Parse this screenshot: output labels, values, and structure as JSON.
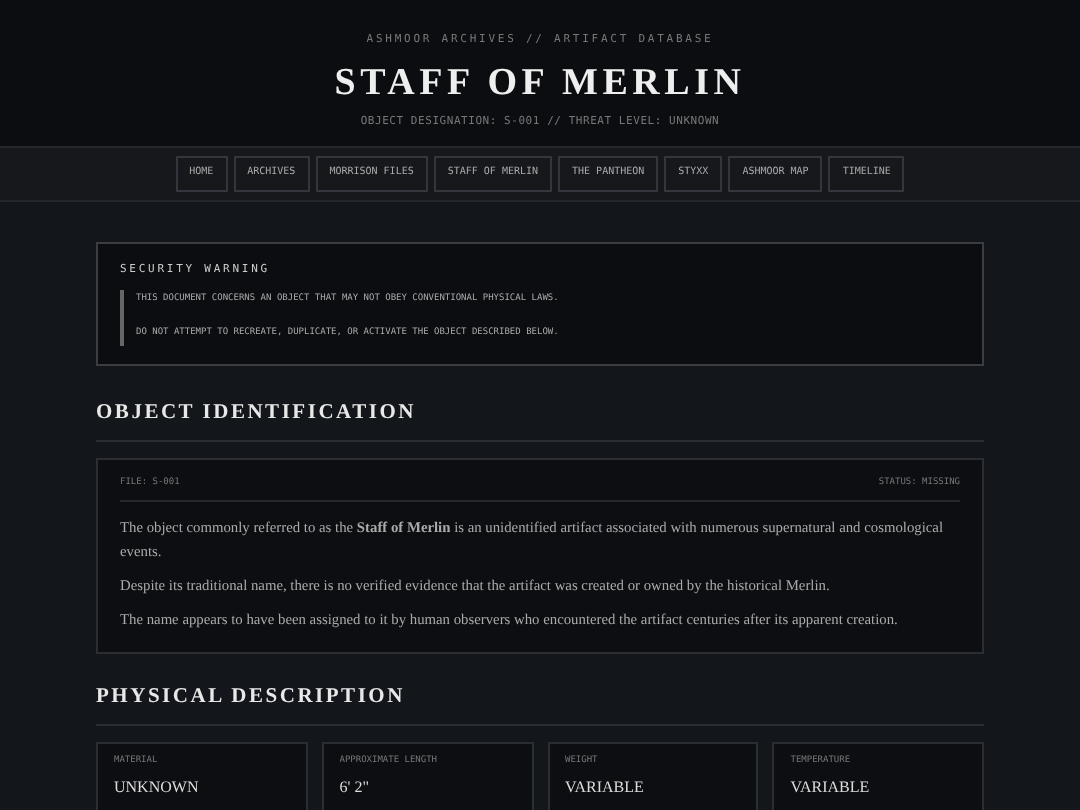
{
  "header": {
    "kicker": "ASHMOOR ARCHIVES // ARTIFACT DATABASE",
    "title": "STAFF OF MERLIN",
    "subtitle": "OBJECT DESIGNATION: S-001 // THREAT LEVEL: UNKNOWN"
  },
  "nav": [
    "HOME",
    "ARCHIVES",
    "MORRISON FILES",
    "STAFF OF MERLIN",
    "THE PANTHEON",
    "STYXX",
    "ASHMOOR MAP",
    "TIMELINE"
  ],
  "warning": {
    "title": "SECURITY WARNING",
    "lines": [
      "THIS DOCUMENT CONCERNS AN OBJECT THAT MAY NOT OBEY CONVENTIONAL PHYSICAL LAWS.",
      "DO NOT ATTEMPT TO RECREATE, DUPLICATE, OR ACTIVATE THE OBJECT DESCRIBED BELOW."
    ]
  },
  "identification": {
    "heading": "OBJECT IDENTIFICATION",
    "file": "FILE: S-001",
    "status": "STATUS: MISSING",
    "paragraphs": [
      "The object commonly referred to as the **Staff of Merlin** is an unidentified artifact associated with numerous supernatural and cosmological events.",
      "Despite its traditional name, there is no verified evidence that the artifact was created or owned by the historical Merlin.",
      "The name appears to have been assigned to it by human observers who encountered the artifact centuries after its apparent creation."
    ]
  },
  "physical": {
    "heading": "PHYSICAL DESCRIPTION",
    "stats": [
      {
        "label": "MATERIAL",
        "value": "UNKNOWN"
      },
      {
        "label": "APPROXIMATE LENGTH",
        "value": "6' 2\""
      },
      {
        "label": "WEIGHT",
        "value": "VARIABLE"
      },
      {
        "label": "TEMPERATURE",
        "value": "VARIABLE"
      }
    ]
  }
}
